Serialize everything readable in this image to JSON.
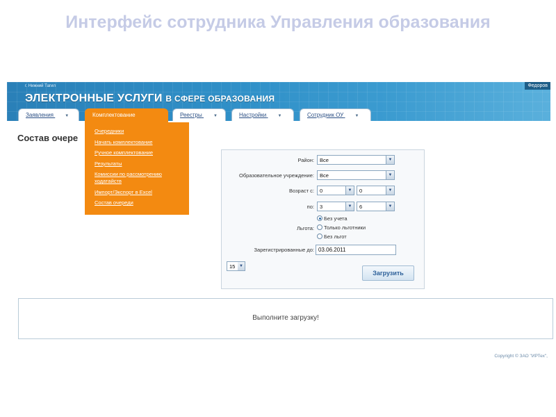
{
  "slide": {
    "title": "Интерфейс сотрудника Управления образования"
  },
  "header": {
    "city": "г. Нижний Тагил",
    "brand_main": "ЭЛЕКТРОННЫЕ УСЛУГИ",
    "brand_sub": "В СФЕРЕ ОБРАЗОВАНИЯ",
    "user": "Федоров"
  },
  "tabs": [
    {
      "label": "Заявления",
      "arrow": "▼"
    },
    {
      "label": "Комплектование",
      "arrow": ""
    },
    {
      "label": "Реестры",
      "arrow": "▼"
    },
    {
      "label": "Настройки",
      "arrow": "▼"
    },
    {
      "label": "Сотрудник ОУ",
      "arrow": "▼"
    }
  ],
  "dropdown": {
    "items": [
      "Очередники",
      "Начать комплектование",
      "Ручное комплектование",
      "Результаты",
      "Комиссии по рассмотрению ходатайств",
      "Импорт/Экспорт в Excel",
      "Состав очереди"
    ]
  },
  "page": {
    "heading": "Состав очере"
  },
  "form": {
    "district_label": "Район:",
    "district_value": "Все",
    "institution_label": "Образовательное учреждение:",
    "institution_value": "Все",
    "age_from_label": "Возраст с:",
    "age_from_years": "0",
    "age_from_months": "0",
    "age_to_label": "по:",
    "age_to_years": "3",
    "age_to_months": "6",
    "benefit_label": "Льгота:",
    "benefit_options": [
      "Без учета",
      "Только льготники",
      "Без льгот"
    ],
    "benefit_selected": "Без учета",
    "registered_label": "Зарегистрированные до:",
    "registered_value": "03.06.2011",
    "page_size": "15",
    "load_button": "Загрузить",
    "dropdown_icon": "▼"
  },
  "result": {
    "message": "Выполните загрузку!"
  },
  "footer": {
    "copyright": "Copyright © ЗАО \"ИРТех\","
  }
}
